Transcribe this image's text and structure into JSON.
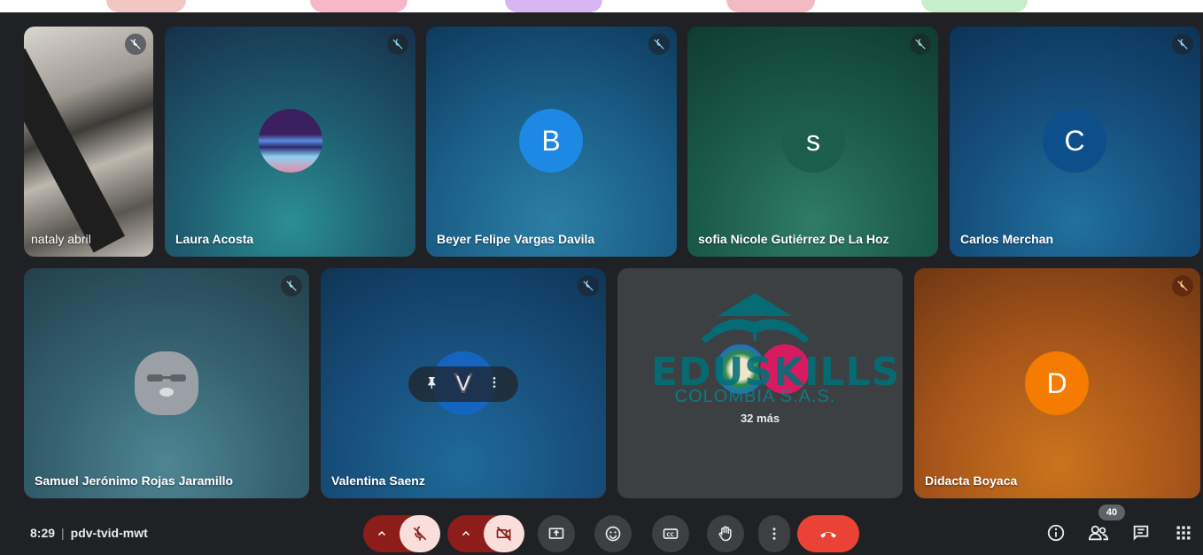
{
  "tiles": [
    {
      "name": "nataly abril",
      "type": "video"
    },
    {
      "name": "Laura Acosta",
      "type": "photo"
    },
    {
      "name": "Beyer Felipe Vargas Davila",
      "initial": "B",
      "avatar_color": "#1e88e5"
    },
    {
      "name": "sofia Nicole Gutiérrez De La Hoz",
      "initial": "s",
      "avatar_color": "#1b5e4a"
    },
    {
      "name": "Carlos Merchan",
      "initial": "C",
      "avatar_color": "#0d4f8b"
    },
    {
      "name": "Samuel Jerónimo Rojas Jaramillo",
      "type": "animal-avatar"
    },
    {
      "name": "Valentina Saenz",
      "initial": "V",
      "avatar_color": "#1565c0"
    },
    {
      "overflow_label": "32 más"
    },
    {
      "name": "Didacta Boyaca",
      "initial": "D",
      "avatar_color": "#f57c00"
    }
  ],
  "watermark": {
    "title": "EDUSKILLS",
    "subtitle": "COLOMBIA S.A.S."
  },
  "meeting": {
    "time": "8:29",
    "separator": "|",
    "code": "pdv-tvid-mwt"
  },
  "people_count": "40",
  "icons": {
    "mic_off": "mic-off-icon",
    "cam_off": "videocam-off-icon",
    "present": "present-screen-icon",
    "emoji": "emoji-icon",
    "captions": "closed-captions-icon",
    "raise_hand": "raise-hand-icon",
    "more": "more-vert-icon",
    "leave": "call-end-icon",
    "info": "info-icon",
    "people": "people-icon",
    "chat": "chat-icon",
    "activities": "apps-icon",
    "pin": "pin-icon"
  },
  "colors": {
    "background": "#202124",
    "leave": "#ea4335",
    "mic_active_bg": "#f9dedc",
    "mic_toggle_bg": "#8c1d18"
  }
}
